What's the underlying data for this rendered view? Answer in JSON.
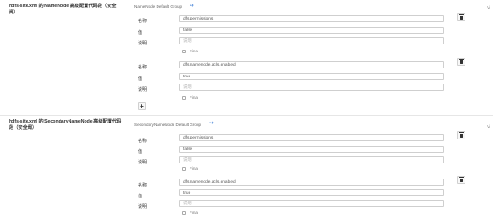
{
  "sections": [
    {
      "title": "hdfs-site.xml 的 NameNode 高级配置代码段（安全阀）",
      "group_label": "NameNode Default Group",
      "side_label": "Vi",
      "entries": [
        {
          "name_label": "名称",
          "value_label": "值",
          "desc_label": "说明",
          "name": "dfs.permissions",
          "value": "false",
          "desc_placeholder": "说明",
          "final_label": "Final"
        },
        {
          "name_label": "名称",
          "value_label": "值",
          "desc_label": "说明",
          "name": "dfs.namenode.acls.enabled",
          "value": "true",
          "desc_placeholder": "说明",
          "final_label": "Final"
        }
      ],
      "add_label": "+"
    },
    {
      "title": "hdfs-site.xml 的 SecondaryNameNode 高级配置代码段（安全阀）",
      "group_label": "SecondaryNameNode Default Group",
      "side_label": "Vi",
      "entries": [
        {
          "name_label": "名称",
          "value_label": "值",
          "desc_label": "说明",
          "name": "dfs.permissions",
          "value": "false",
          "desc_placeholder": "说明",
          "final_label": "Final"
        },
        {
          "name_label": "名称",
          "value_label": "值",
          "desc_label": "说明",
          "name": "dfs.namenode.acls.enabled",
          "value": "true",
          "desc_placeholder": "说明",
          "final_label": "Final"
        }
      ]
    }
  ],
  "pin_icon": "pin-icon",
  "delete_icon": "trash-icon",
  "accent_color": "#3a7bd5"
}
